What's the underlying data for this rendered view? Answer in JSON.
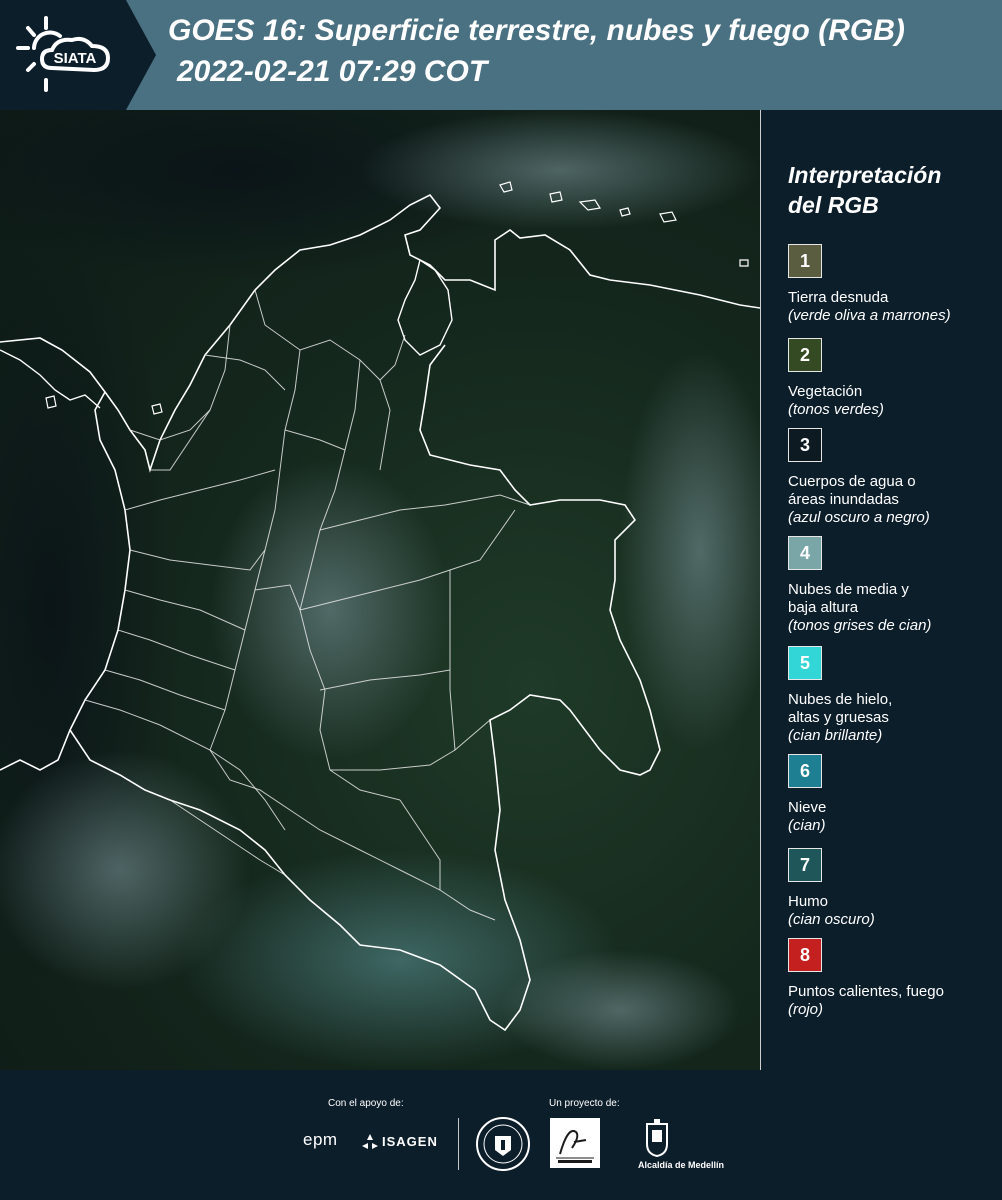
{
  "header": {
    "logo_text": "SIATA",
    "title_line1": "GOES 16: Superficie terrestre, nubes y fuego (RGB)",
    "title_line2": "2022-02-21 07:29 COT"
  },
  "legend": {
    "title_line1": "Interpretación",
    "title_line2": "del RGB",
    "items": [
      {
        "number": "1",
        "color": "#5a5d40",
        "lines": [
          "Tierra desnuda"
        ],
        "desc": "(verde oliva a marrones)"
      },
      {
        "number": "2",
        "color": "#344a22",
        "lines": [
          "Vegetación"
        ],
        "desc": "(tonos verdes)"
      },
      {
        "number": "3",
        "color": "#0d1a22",
        "lines": [
          "Cuerpos de agua o",
          "áreas inundadas"
        ],
        "desc": "(azul oscuro a negro)"
      },
      {
        "number": "4",
        "color": "#7aa6a8",
        "lines": [
          "Nubes de media y",
          "baja altura"
        ],
        "desc": "(tonos grises de cian)"
      },
      {
        "number": "5",
        "color": "#33d6d6",
        "lines": [
          "Nubes de hielo,",
          "altas y gruesas"
        ],
        "desc": "(cian brillante)"
      },
      {
        "number": "6",
        "color": "#1e7f93",
        "lines": [
          "Nieve"
        ],
        "desc": "(cian)"
      },
      {
        "number": "7",
        "color": "#1f5659",
        "lines": [
          "Humo"
        ],
        "desc": "(cian oscuro)"
      },
      {
        "number": "8",
        "color": "#c4201f",
        "lines": [
          "Puntos calientes, fuego"
        ],
        "desc": "(rojo)"
      }
    ]
  },
  "footer": {
    "support_label": "Con el apoyo de:",
    "project_label": "Un proyecto de:",
    "sponsor1": "epm",
    "sponsor2": "ISAGEN",
    "partner_alcaldia": "Alcaldía de Medellín"
  },
  "colors": {
    "header_bg": "#4a7181",
    "page_bg": "#0d1e2b",
    "border_lines": "#ffffff"
  }
}
